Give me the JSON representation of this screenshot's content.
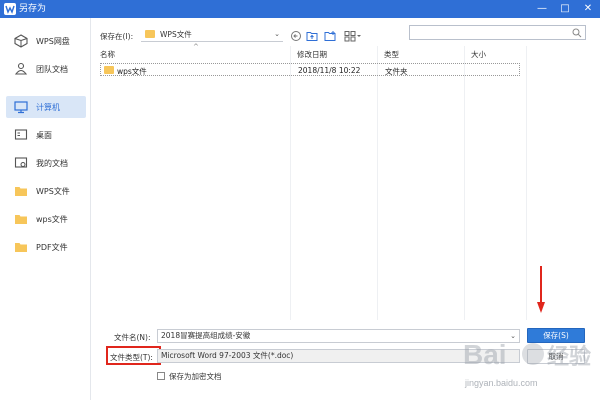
{
  "window": {
    "title": "另存为",
    "minimize_glyph": "—",
    "maximize_glyph": "□",
    "close_glyph": "✕",
    "accent_color": "#2f6fd6"
  },
  "sidebar": {
    "items": [
      {
        "label": "WPS网盘",
        "icon": "cloud-drive-icon"
      },
      {
        "label": "团队文档",
        "icon": "team-icon"
      },
      {
        "label": "计算机",
        "icon": "computer-icon",
        "active": true
      },
      {
        "label": "桌面",
        "icon": "desktop-icon"
      },
      {
        "label": "我的文档",
        "icon": "my-documents-icon"
      },
      {
        "label": "WPS文件",
        "icon": "folder-icon"
      },
      {
        "label": "wps文件",
        "icon": "folder-icon"
      },
      {
        "label": "PDF文件",
        "icon": "folder-icon"
      }
    ]
  },
  "toolbar": {
    "save_in_label": "保存在(I):",
    "location": "WPS文件",
    "icons": [
      "back-icon",
      "up-folder-icon",
      "new-folder-icon",
      "view-icon"
    ],
    "search_placeholder": ""
  },
  "file_list": {
    "columns": [
      "名称",
      "修改日期",
      "类型",
      "大小"
    ],
    "rows": [
      {
        "name": "wps文件",
        "modified": "2018/11/8 10:22",
        "type": "文件夹",
        "size": ""
      }
    ]
  },
  "form": {
    "filename_label": "文件名(N):",
    "filename_value": "2018冒赛提高组成绩-安徽",
    "filetype_label": "文件类型(T):",
    "filetype_value": "Microsoft Word 97-2003 文件(*.doc)",
    "encrypt_label": "保存为加密文档",
    "save_button": "保存(S)",
    "cancel_button": "取消"
  },
  "watermark": {
    "text": "Baidu经验",
    "url": "jingyan.baidu.com"
  }
}
